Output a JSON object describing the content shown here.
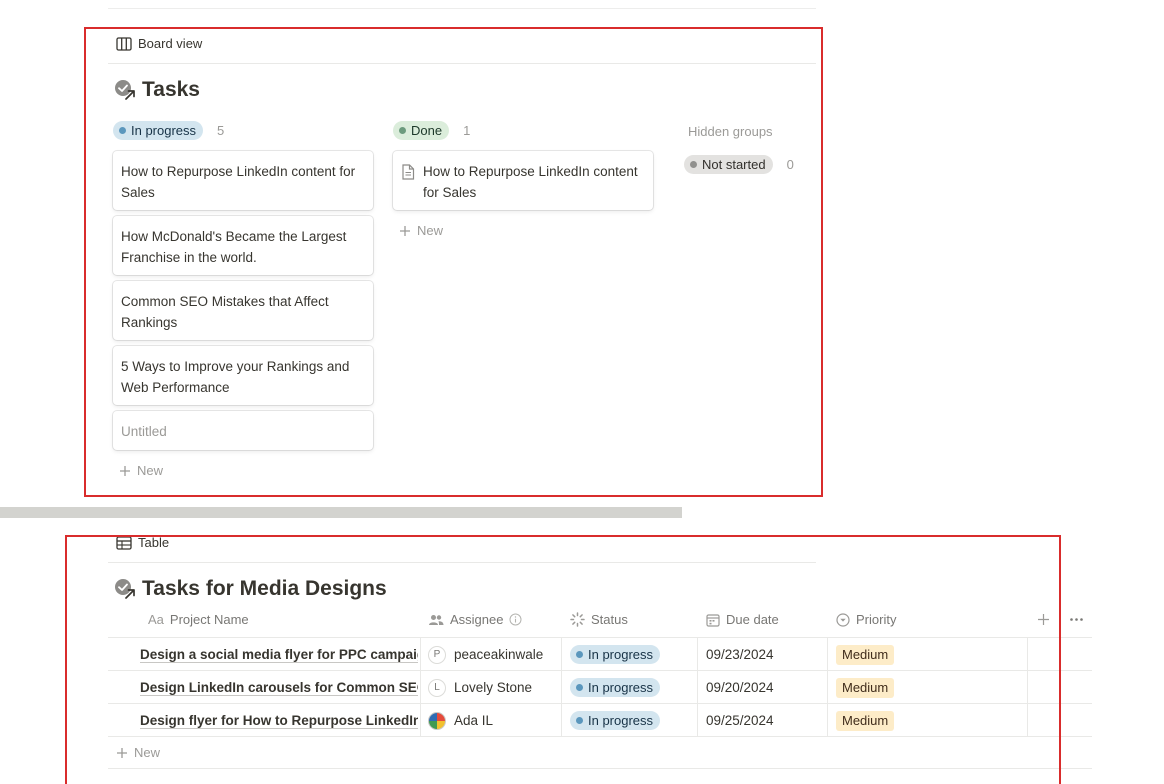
{
  "board": {
    "view_tab": "Board view",
    "title": "Tasks",
    "columns": [
      {
        "status": "In progress",
        "count": "5",
        "cards": [
          "How to Repurpose LinkedIn content for Sales",
          "How McDonald's Became the Largest Franchise in the world.",
          "Common SEO Mistakes that Affect Rankings",
          "5 Ways to Improve your Rankings and Web Performance",
          "Untitled"
        ],
        "new_label": "New"
      },
      {
        "status": "Done",
        "count": "1",
        "cards": [
          "How to Repurpose LinkedIn content for Sales"
        ],
        "new_label": "New"
      }
    ],
    "hidden_groups": {
      "label": "Hidden groups",
      "groups": [
        {
          "status": "Not started",
          "count": "0"
        }
      ]
    }
  },
  "table": {
    "view_tab": "Table",
    "title": "Tasks for Media Designs",
    "headers": {
      "name": "Project Name",
      "name_icon": "Aa",
      "assignee": "Assignee",
      "status": "Status",
      "due": "Due date",
      "priority": "Priority"
    },
    "rows": [
      {
        "name": "Design a social media flyer for PPC campaign",
        "assignee_initial": "P",
        "assignee": "peaceakinwale",
        "status": "In progress",
        "due": "09/23/2024",
        "priority": "Medium"
      },
      {
        "name": "Design LinkedIn carousels for Common SEO",
        "assignee_initial": "L",
        "assignee": "Lovely Stone",
        "status": "In progress",
        "due": "09/20/2024",
        "priority": "Medium"
      },
      {
        "name": "Design flyer for How to Repurpose LinkedIn content",
        "assignee_initial": "",
        "assignee": "Ada IL",
        "status": "In progress",
        "due": "09/25/2024",
        "priority": "Medium"
      }
    ],
    "new_label": "New"
  },
  "colors": {
    "highlight_border": "#d92c2c",
    "in_progress_bg": "#d3e5ef",
    "done_bg": "#dbeddb",
    "not_started_bg": "#e3e2e0",
    "priority_medium_bg": "#fdecc8"
  }
}
